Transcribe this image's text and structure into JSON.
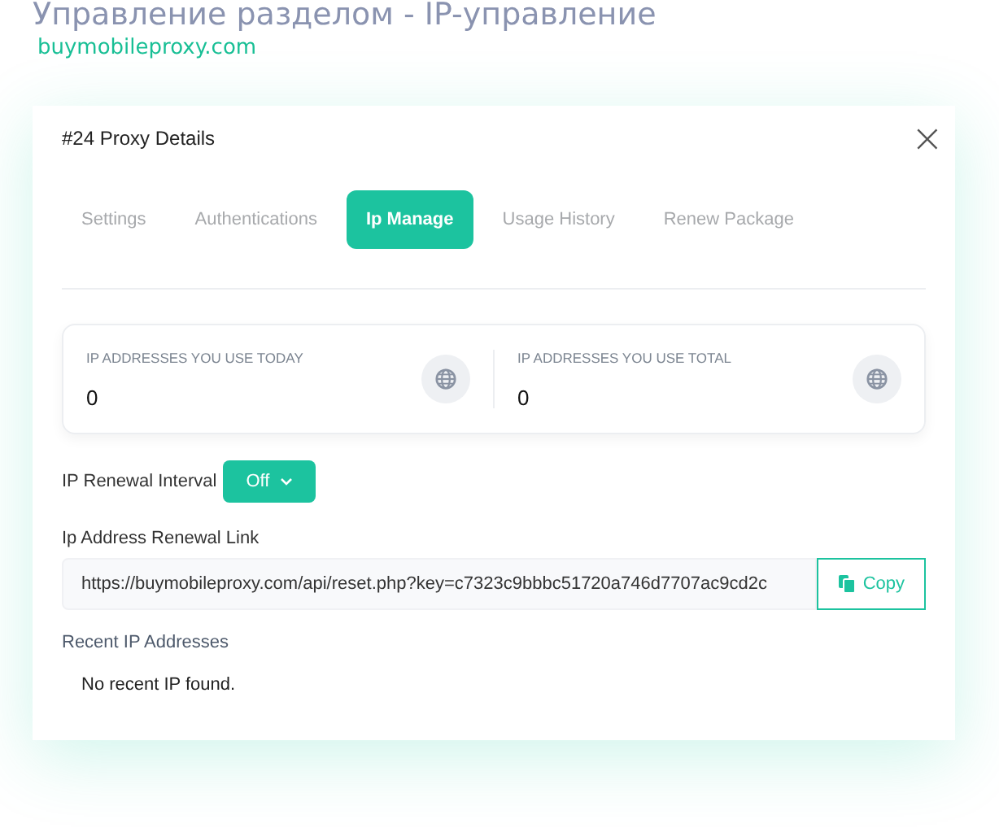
{
  "page_title": "Управление разделом - IP-управление",
  "site": "buymobileproxy.com",
  "dialog": {
    "title": "#24 Proxy Details",
    "close": "×",
    "tabs": [
      {
        "label": "Settings",
        "selected": false
      },
      {
        "label": "Authentications",
        "selected": false
      },
      {
        "label": "Ip Manage",
        "selected": true
      },
      {
        "label": "Usage History",
        "selected": false
      },
      {
        "label": "Renew Package",
        "selected": false
      }
    ],
    "stats": [
      {
        "label": "IP ADDRESSES YOU USE TODAY",
        "value": "0"
      },
      {
        "label": "IP ADDRESSES YOU USE TOTAL",
        "value": "0"
      }
    ],
    "renewal_interval": {
      "label": "IP Renewal Interval",
      "value": "Off"
    },
    "renewal_link": {
      "label": "Ip Address Renewal Link",
      "value": "https://buymobileproxy.com/api/reset.php?key=c7323c9bbbc51720a746d7707ac9cd2c",
      "copy_button": "Copy"
    },
    "recent": {
      "label": "Recent IP Addresses",
      "empty": "No recent IP found."
    }
  }
}
